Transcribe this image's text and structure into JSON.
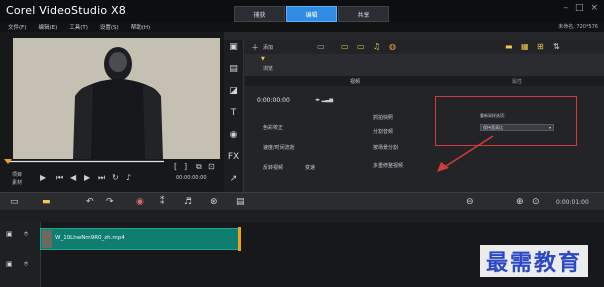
{
  "app": {
    "title": "Corel VideoStudio X8"
  },
  "workspace_tabs": [
    {
      "label": "捕获"
    },
    {
      "label": "编辑"
    },
    {
      "label": "共享"
    }
  ],
  "menu": [
    "文件(F)",
    "编辑(E)",
    "工具(T)",
    "设置(S)",
    "帮助(H)"
  ],
  "project_info": "未命名, 720*576",
  "player": {
    "project_label": "项目",
    "clip_label": "素材",
    "timecode": "00:00:00:00"
  },
  "library": {
    "add_label": "添加",
    "browse_label": "浏览",
    "options": {
      "tabs": {
        "video": "视频",
        "attribute": "属性"
      },
      "timecode": "0:00:00:00",
      "items": [
        {
          "label": "色彩校正"
        },
        {
          "label": "速度/时间流逝"
        },
        {
          "label": "反转视频"
        },
        {
          "label": "变速"
        },
        {
          "label": "抓拍快照"
        },
        {
          "label": "分割音频"
        },
        {
          "label": "按场景分割"
        },
        {
          "label": "多重修整视频"
        }
      ],
      "resample_label": "重新采样选项：",
      "resample_value": "保持宽高比"
    }
  },
  "timeline": {
    "timecode": "0:00:01:00",
    "clip_name": "W_10LhwNm9R0_zh.mp4"
  },
  "watermark": "最需教育",
  "colors": {
    "accent": "#2f8be3",
    "clip": "#0f7d6f",
    "highlight": "#d23b3b"
  }
}
